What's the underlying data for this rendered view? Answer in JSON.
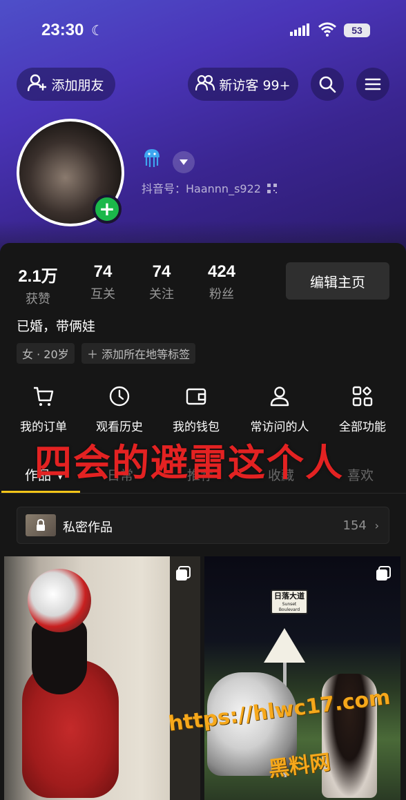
{
  "status_bar": {
    "time": "23:30",
    "battery": "53"
  },
  "header": {
    "add_friend_label": "添加朋友",
    "new_visitors_label": "新访客 99+"
  },
  "profile": {
    "badge_icon": "jellyfish-icon",
    "douyin_id": "抖音号：Haannn_s922"
  },
  "stats": [
    {
      "num": "2.1万",
      "label": "获赞"
    },
    {
      "num": "74",
      "label": "互关"
    },
    {
      "num": "74",
      "label": "关注"
    },
    {
      "num": "424",
      "label": "粉丝"
    }
  ],
  "edit_profile_label": "编辑主页",
  "bio": "已婚，带俩娃",
  "tags": [
    "女 · 20岁",
    "＋ 添加所在地等标签"
  ],
  "functions": [
    {
      "label": "我的订单",
      "icon": "cart-icon"
    },
    {
      "label": "观看历史",
      "icon": "clock-icon"
    },
    {
      "label": "我的钱包",
      "icon": "wallet-icon"
    },
    {
      "label": "常访问的人",
      "icon": "person-icon"
    },
    {
      "label": "全部功能",
      "icon": "grid-icon"
    }
  ],
  "overlay_caption": "四会的避雷这个人",
  "tabs": [
    {
      "label": "作品",
      "active": true
    },
    {
      "label": "日常",
      "active": false
    },
    {
      "label": "推荐",
      "active": false
    },
    {
      "label": "收藏",
      "active": false
    },
    {
      "label": "喜欢",
      "active": false
    }
  ],
  "private_works": {
    "label": "私密作品",
    "count": "154"
  },
  "video_2_sign": {
    "title": "日落大道",
    "subtitle": "Sunset Boulevard"
  },
  "watermark": {
    "url": "https://hlwc17.com",
    "name": "黑料网"
  },
  "colors": {
    "accent_underline": "#f5c518",
    "add_button_green": "#1bb84a",
    "overlay_red": "#e32222",
    "watermark_orange": "#f6a81b"
  }
}
